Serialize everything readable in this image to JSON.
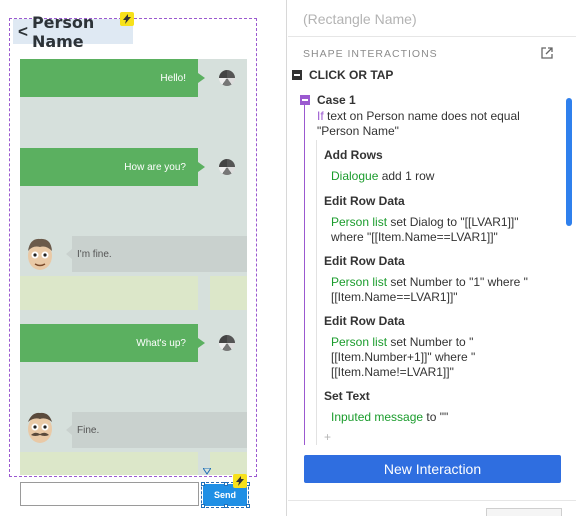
{
  "canvas": {
    "page_title": "Person Name",
    "messages": [
      {
        "side": "right",
        "text": "Hello!"
      },
      {
        "side": "right",
        "text": "How are you?"
      },
      {
        "side": "left",
        "text": "I'm fine."
      },
      {
        "side": "right",
        "text": "What's up?"
      },
      {
        "side": "left",
        "text": "Fine."
      }
    ],
    "send_label": "Send"
  },
  "panel": {
    "shape_name": "(Rectangle Name)",
    "section_label": "SHAPE INTERACTIONS",
    "event_label": "CLICK OR TAP",
    "case_label": "Case 1",
    "condition": {
      "keyword": "If",
      "text": " text on Person name does not equal \"Person Name\""
    },
    "actions": [
      {
        "title": "Add Rows",
        "target": "Dialogue",
        "rest": " add 1 row"
      },
      {
        "title": "Edit Row Data",
        "target": "Person list",
        "rest": " set Dialog to \"[[LVAR1]]\" where \"[[Item.Name==LVAR1]]\""
      },
      {
        "title": "Edit Row Data",
        "target": "Person list",
        "rest": " set Number to \"1\" where \"[[Item.Name==LVAR1]]\""
      },
      {
        "title": "Edit Row Data",
        "target": "Person list",
        "rest": " set Number to \"[[Item.Number+1]]\" where \"[[Item.Name!=LVAR1]]\""
      },
      {
        "title": "Set Text",
        "target": "Inputed message",
        "rest": " to \"\""
      }
    ],
    "add_symbol": "+",
    "new_interaction_label": "New Interaction"
  },
  "colors": {
    "accent_blue": "#2f6ee0",
    "case_purple": "#9b59d0",
    "target_green": "#1a9c2c",
    "bubble_green": "#5bb060",
    "lightning_yellow": "#f7e11b"
  }
}
